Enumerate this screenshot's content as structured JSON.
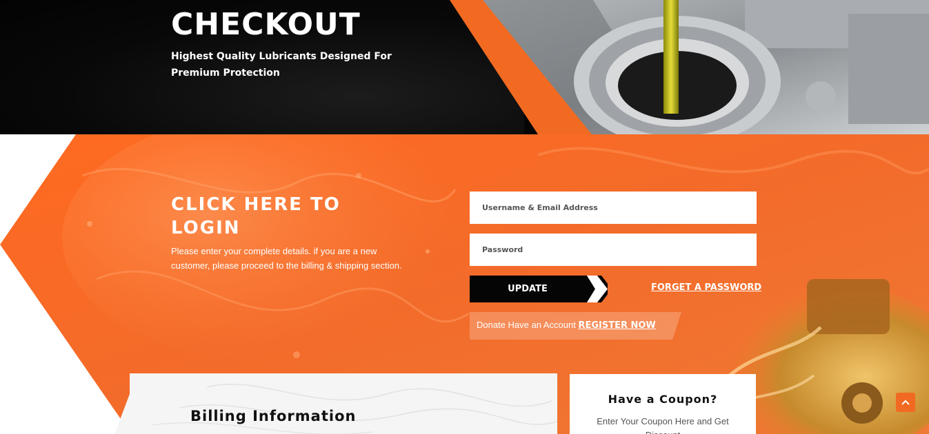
{
  "hero": {
    "title": "CHECKOUT",
    "subtitle": "Highest Quality Lubricants Designed For Premium Protection"
  },
  "login": {
    "heading": "CLICK HERE TO LOGIN",
    "description": "Please enter your complete details. if you are a new customer, please proceed to the billing & shipping section.",
    "username_placeholder": "Username & Email Address",
    "password_placeholder": "Password",
    "update_label": "UPDATE",
    "forget_label": "FORGET A PASSWORD",
    "register_prefix": "Donate Have an Account",
    "register_label": "REGISTER NOW"
  },
  "billing": {
    "title": "Billing Information"
  },
  "coupon": {
    "title": "Have a Coupon?",
    "description": "Enter Your Coupon Here and Get Discount"
  },
  "icons": {
    "scroll_top": "chevron-up-icon",
    "update_arrow": "chevron-right-icon"
  },
  "colors": {
    "accent_orange": "#f26a21",
    "dark": "#050505",
    "white": "#ffffff"
  }
}
